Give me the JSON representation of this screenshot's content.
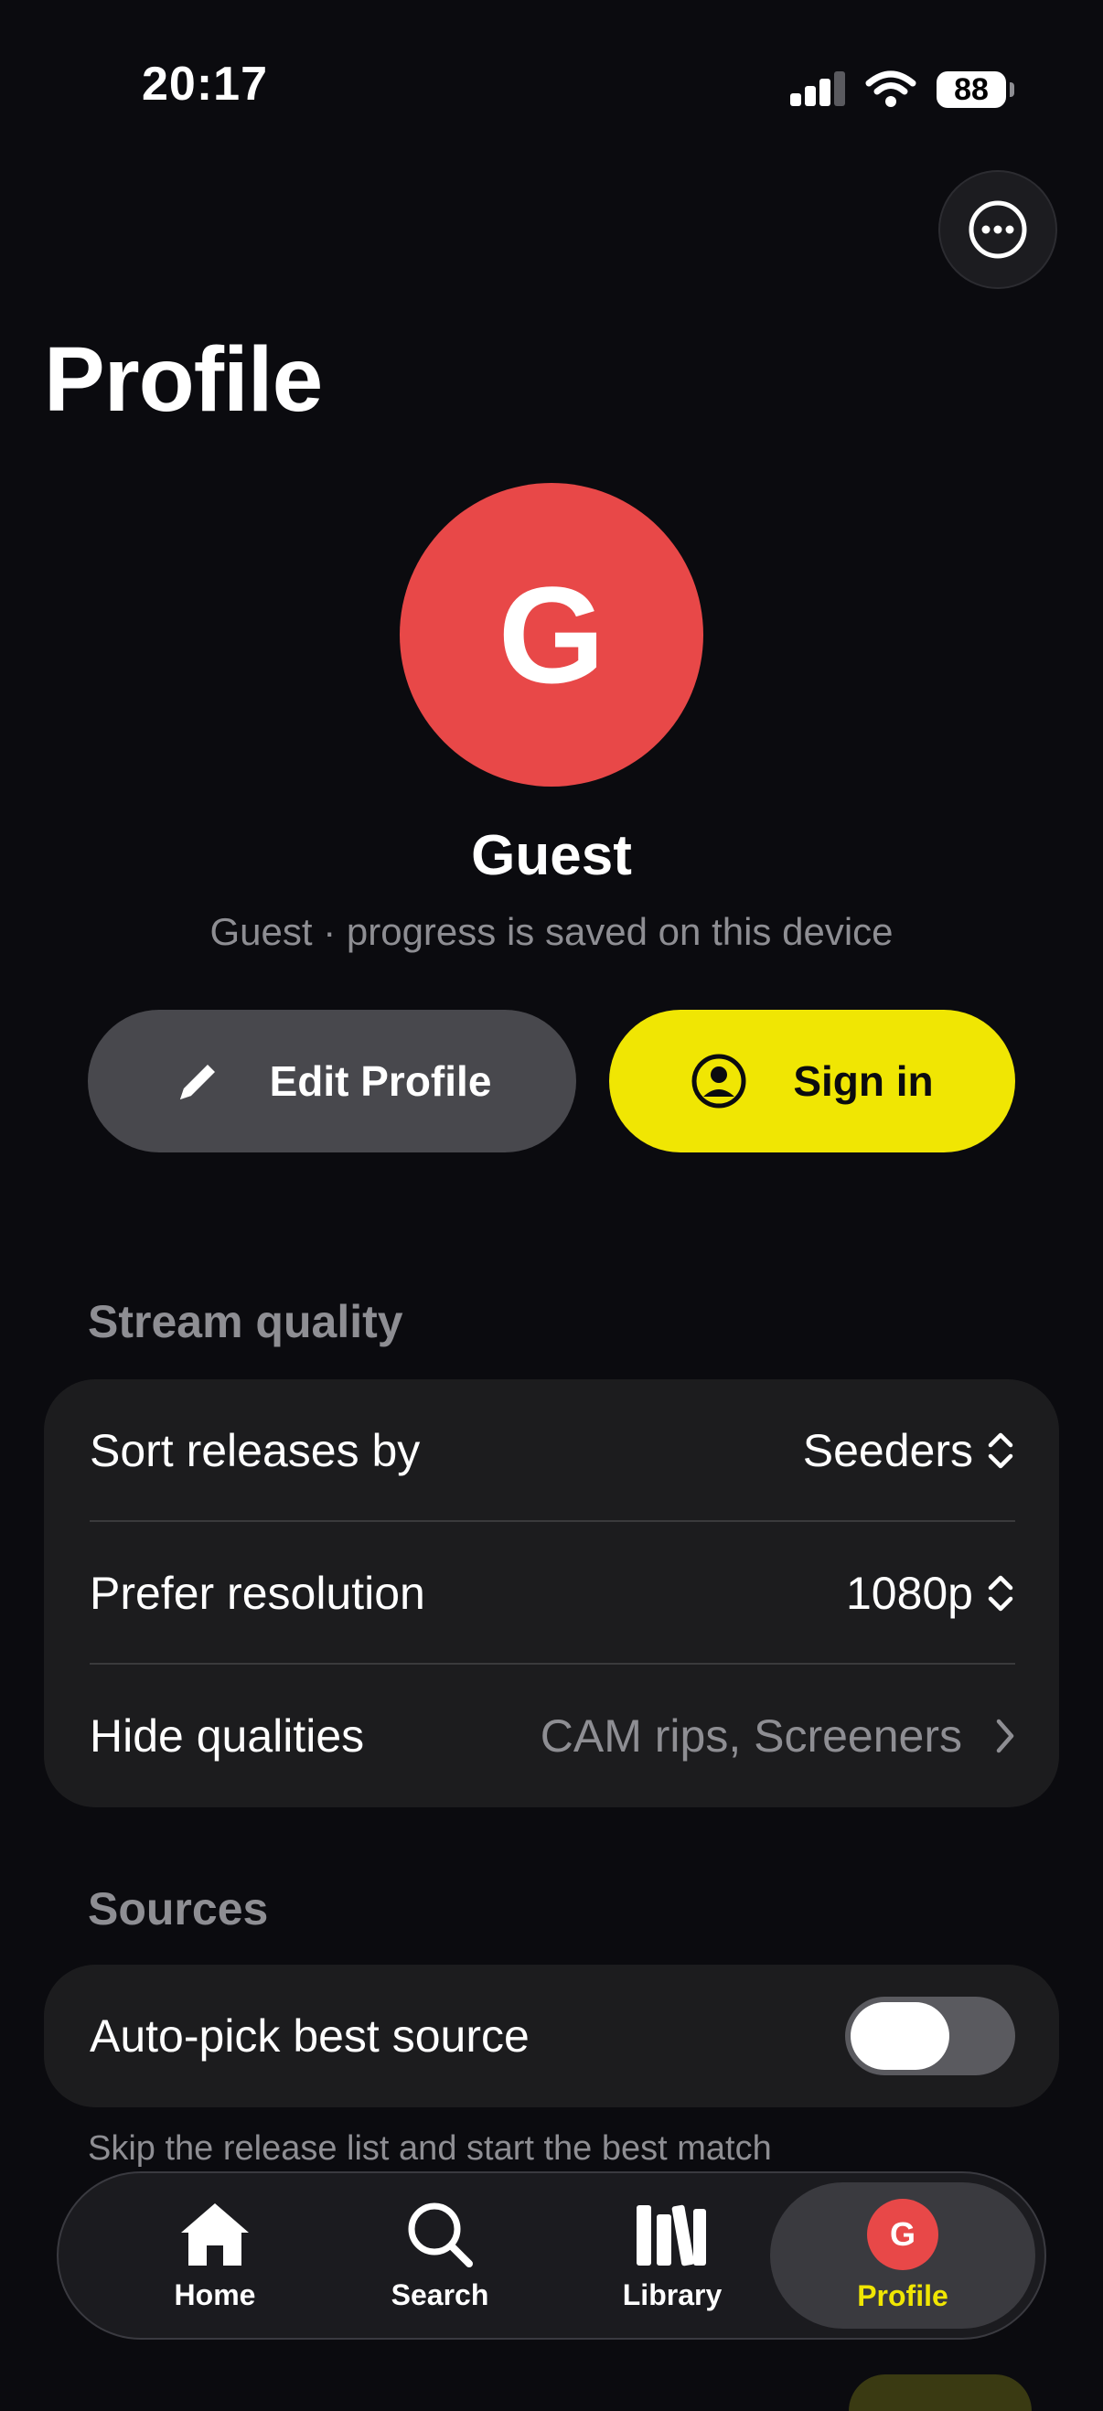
{
  "status_bar": {
    "time": "20:17",
    "battery": "88"
  },
  "page": {
    "title": "Profile"
  },
  "user": {
    "avatar_initial": "G",
    "name": "Guest",
    "subtitle": "Guest · progress is saved on this device"
  },
  "actions": {
    "edit_label": "Edit Profile",
    "signin_label": "Sign in"
  },
  "stream_quality": {
    "header": "Stream quality",
    "rows": [
      {
        "label": "Sort releases by",
        "value": "Seeders"
      },
      {
        "label": "Prefer resolution",
        "value": "1080p"
      },
      {
        "label": "Hide qualities",
        "value": "CAM rips, Screeners"
      }
    ]
  },
  "sources": {
    "header": "Sources",
    "auto_pick_label": "Auto-pick best source",
    "auto_pick_on": false,
    "helper": "Skip the release list and start the best match"
  },
  "tabbar": {
    "tabs": [
      {
        "label": "Home",
        "icon": "home-icon"
      },
      {
        "label": "Search",
        "icon": "search-icon"
      },
      {
        "label": "Library",
        "icon": "library-icon"
      },
      {
        "label": "Profile",
        "icon": "avatar",
        "active": true
      }
    ],
    "profile_initial": "G"
  },
  "colors": {
    "accent": "#f0e603",
    "avatar": "#e84848",
    "background": "#0b0b0f",
    "card": "#1c1c1e"
  }
}
